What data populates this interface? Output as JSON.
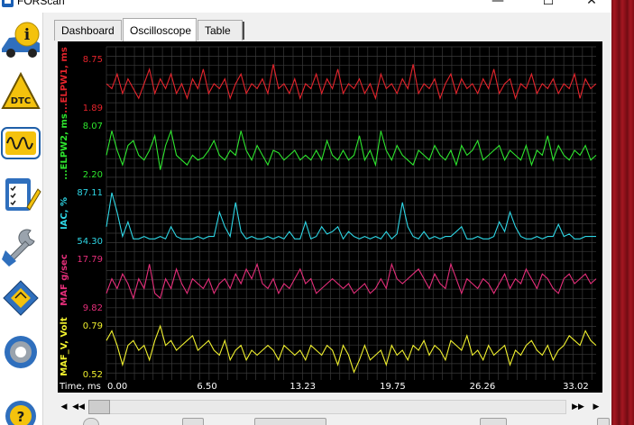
{
  "window": {
    "title": "FORScan",
    "min_glyph": "—",
    "max_glyph": "☐",
    "close_glyph": "✕"
  },
  "sidebar": {
    "items": [
      {
        "name": "info-icon",
        "label": "i"
      },
      {
        "name": "dtc-icon",
        "label": "DTC"
      },
      {
        "name": "oscilloscope-icon"
      },
      {
        "name": "checklist-icon"
      },
      {
        "name": "wrench-icon"
      },
      {
        "name": "chip-icon"
      },
      {
        "name": "gear-icon"
      },
      {
        "name": "help-icon",
        "label": "?"
      }
    ]
  },
  "tabs": [
    {
      "label": "Dashboard",
      "active": false
    },
    {
      "label": "Oscilloscope",
      "active": true
    },
    {
      "label": "Table",
      "active": false
    }
  ],
  "scope": {
    "colors": {
      "background": "#000000",
      "grid": "#3a3a3a",
      "time": "#ffffff"
    },
    "time_label": "Time, ms",
    "time_ticks": [
      {
        "value": 0.0,
        "label": "0.00"
      },
      {
        "value": 6.5,
        "label": "6.50"
      },
      {
        "value": 13.23,
        "label": "13.23"
      },
      {
        "value": 19.75,
        "label": "19.75"
      },
      {
        "value": 26.26,
        "label": "26.26"
      },
      {
        "value": 33.02,
        "label": "33.02"
      }
    ],
    "channels": [
      {
        "label": "...ELPW1, ms",
        "max": "8.75",
        "min": "1.89",
        "color": "#e5242c",
        "values": [
          0.5,
          0.4,
          0.7,
          0.3,
          0.6,
          0.4,
          0.2,
          0.5,
          0.8,
          0.3,
          0.6,
          0.4,
          0.7,
          0.3,
          0.5,
          0.2,
          0.6,
          0.4,
          0.8,
          0.3,
          0.5,
          0.4,
          0.6,
          0.2,
          0.5,
          0.7,
          0.3,
          0.5,
          0.4,
          0.6,
          0.3,
          0.9,
          0.4,
          0.5,
          0.3,
          0.6,
          0.2,
          0.5,
          0.4,
          0.7,
          0.3,
          0.6,
          0.4,
          0.8,
          0.3,
          0.5,
          0.4,
          0.6,
          0.3,
          0.5,
          0.2,
          0.7,
          0.4,
          0.5,
          0.3,
          0.6,
          0.4,
          0.9,
          0.3,
          0.5,
          0.4,
          0.6,
          0.2,
          0.5,
          0.7,
          0.3,
          0.6,
          0.4,
          0.5,
          0.3,
          0.6,
          0.4,
          0.8,
          0.3,
          0.5,
          0.6,
          0.2,
          0.5,
          0.4,
          0.7,
          0.3,
          0.5,
          0.4,
          0.6,
          0.3,
          0.5,
          0.4,
          0.7,
          0.2,
          0.6,
          0.4,
          0.5
        ]
      },
      {
        "label": "...ELPW2, ms",
        "max": "8.07",
        "min": "2.20",
        "color": "#2ee52e",
        "values": [
          0.4,
          0.9,
          0.5,
          0.2,
          0.6,
          0.7,
          0.4,
          0.3,
          0.5,
          0.8,
          0.1,
          0.6,
          0.9,
          0.4,
          0.3,
          0.2,
          0.4,
          0.3,
          0.35,
          0.5,
          0.7,
          0.4,
          0.3,
          0.5,
          0.4,
          0.9,
          0.5,
          0.3,
          0.6,
          0.4,
          0.2,
          0.5,
          0.45,
          0.3,
          0.4,
          0.5,
          0.3,
          0.4,
          0.3,
          0.5,
          0.3,
          0.7,
          0.4,
          0.3,
          0.5,
          0.3,
          0.4,
          0.8,
          0.3,
          0.5,
          0.2,
          0.9,
          0.5,
          0.3,
          0.6,
          0.4,
          0.3,
          0.2,
          0.5,
          0.4,
          0.3,
          0.6,
          0.4,
          0.3,
          0.5,
          0.2,
          0.6,
          0.4,
          0.5,
          0.7,
          0.3,
          0.4,
          0.5,
          0.6,
          0.3,
          0.5,
          0.4,
          0.3,
          0.6,
          0.2,
          0.5,
          0.4,
          0.8,
          0.3,
          0.6,
          0.4,
          0.3,
          0.5,
          0.4,
          0.6,
          0.3,
          0.4
        ]
      },
      {
        "label": "IAC, %",
        "max": "87.11",
        "min": "54.30",
        "color": "#2ed6e5",
        "values": [
          0.3,
          1.0,
          0.6,
          0.1,
          0.4,
          0.05,
          0.05,
          0.1,
          0.05,
          0.05,
          0.1,
          0.05,
          0.3,
          0.1,
          0.05,
          0.05,
          0.05,
          0.1,
          0.05,
          0.1,
          0.1,
          0.6,
          0.3,
          0.1,
          0.8,
          0.2,
          0.05,
          0.1,
          0.05,
          0.05,
          0.1,
          0.05,
          0.1,
          0.05,
          0.2,
          0.05,
          0.05,
          0.4,
          0.05,
          0.1,
          0.3,
          0.15,
          0.2,
          0.3,
          0.05,
          0.2,
          0.1,
          0.05,
          0.1,
          0.05,
          0.1,
          0.05,
          0.2,
          0.05,
          0.15,
          0.8,
          0.3,
          0.1,
          0.05,
          0.2,
          0.05,
          0.1,
          0.05,
          0.1,
          0.1,
          0.2,
          0.3,
          0.05,
          0.05,
          0.1,
          0.05,
          0.05,
          0.1,
          0.4,
          0.2,
          0.6,
          0.3,
          0.1,
          0.05,
          0.05,
          0.1,
          0.05,
          0.1,
          0.1,
          0.35,
          0.1,
          0.15,
          0.05,
          0.05,
          0.1,
          0.1,
          0.1
        ]
      },
      {
        "label": "MAF g/sec",
        "max": "17.79",
        "min": "9.82",
        "color": "#e52e7a",
        "values": [
          0.3,
          0.6,
          0.4,
          0.7,
          0.5,
          0.2,
          0.6,
          0.4,
          0.9,
          0.3,
          0.2,
          0.6,
          0.4,
          0.8,
          0.5,
          0.3,
          0.6,
          0.5,
          0.4,
          0.6,
          0.3,
          0.5,
          0.6,
          0.4,
          0.7,
          0.5,
          0.8,
          0.6,
          0.9,
          0.5,
          0.4,
          0.6,
          0.3,
          0.5,
          0.4,
          0.6,
          0.8,
          0.5,
          0.6,
          0.3,
          0.4,
          0.5,
          0.6,
          0.5,
          0.4,
          0.5,
          0.3,
          0.4,
          0.5,
          0.3,
          0.4,
          0.6,
          0.4,
          0.9,
          0.6,
          0.5,
          0.6,
          0.7,
          0.8,
          0.6,
          0.4,
          0.7,
          0.5,
          0.4,
          0.9,
          0.6,
          0.3,
          0.6,
          0.5,
          0.4,
          0.6,
          0.5,
          0.3,
          0.5,
          0.7,
          0.4,
          0.6,
          0.5,
          0.8,
          0.6,
          0.4,
          0.7,
          0.6,
          0.4,
          0.3,
          0.6,
          0.7,
          0.5,
          0.6,
          0.7,
          0.5,
          0.6
        ]
      },
      {
        "label": "MAF_V, Volt",
        "max": "0.79",
        "min": "0.52",
        "color": "#f0f02e",
        "values": [
          0.7,
          0.9,
          0.6,
          0.2,
          0.6,
          0.7,
          0.5,
          0.6,
          0.3,
          0.7,
          1.0,
          0.6,
          0.7,
          0.5,
          0.6,
          0.7,
          0.8,
          0.5,
          0.6,
          0.7,
          0.5,
          0.4,
          0.7,
          0.3,
          0.5,
          0.6,
          0.3,
          0.5,
          0.4,
          0.5,
          0.6,
          0.5,
          0.3,
          0.6,
          0.5,
          0.4,
          0.5,
          0.3,
          0.6,
          0.5,
          0.4,
          0.6,
          0.5,
          0.2,
          0.6,
          0.4,
          0.05,
          0.3,
          0.6,
          0.3,
          0.4,
          0.5,
          0.2,
          0.6,
          0.4,
          0.5,
          0.3,
          0.6,
          0.5,
          0.7,
          0.4,
          0.6,
          0.5,
          0.3,
          0.7,
          0.6,
          0.5,
          0.8,
          0.4,
          0.5,
          0.3,
          0.6,
          0.4,
          0.5,
          0.6,
          0.2,
          0.5,
          0.4,
          0.6,
          0.7,
          0.5,
          0.4,
          0.6,
          0.3,
          0.5,
          0.6,
          0.8,
          0.7,
          0.6,
          0.9,
          0.7,
          0.6
        ]
      }
    ]
  },
  "scroll": {
    "first": "◀◀",
    "prev": "◀",
    "next": "▶",
    "last": "▶▶"
  }
}
